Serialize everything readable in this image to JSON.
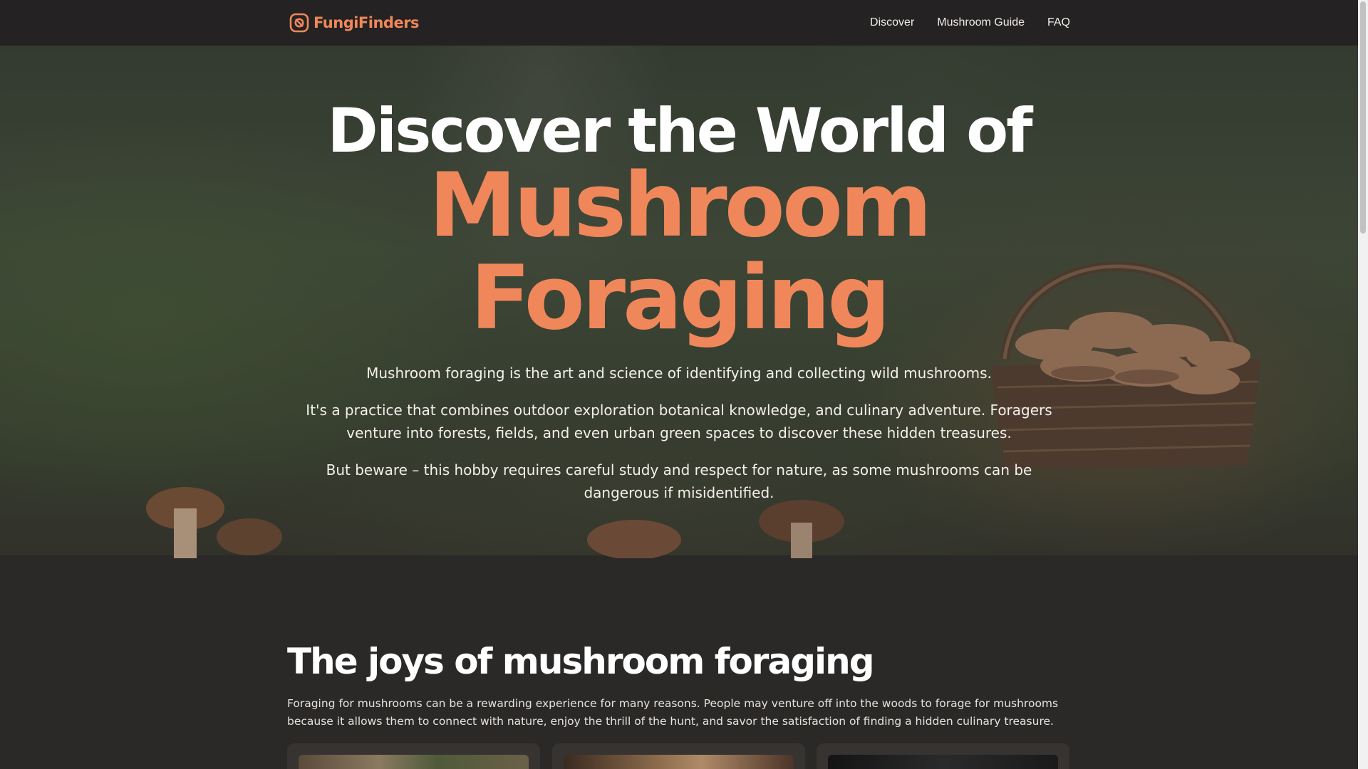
{
  "nav": {
    "brand": "FungiFinders",
    "links": [
      "Discover",
      "Mushroom Guide",
      "FAQ"
    ]
  },
  "hero": {
    "line1": "Discover the World of",
    "line2a": "Mushroom",
    "line2b": "Foraging",
    "p1": "Mushroom foraging is the art and science of identifying and collecting wild mushrooms.",
    "p2": "It's a practice that combines outdoor exploration botanical knowledge, and culinary adventure. Foragers venture into forests, fields, and even urban green spaces to discover these hidden treasures.",
    "p3": "But beware – this hobby requires careful study and respect for nature, as some mushrooms can be dangerous if misidentified."
  },
  "joys": {
    "title": "The joys of mushroom foraging",
    "text": "Foraging for mushrooms can be a rewarding experience for many reasons. People may venture off into the woods to forage for mushrooms because it allows them to connect with nature, enjoy the thrill of the hunt, and savor the satisfaction of finding a hidden culinary treasure."
  },
  "colors": {
    "accent": "#f0875a",
    "background": "#2b2928",
    "nav": "#242222",
    "card": "#363331"
  },
  "icons": {
    "brand": "mushroom-logo-icon"
  }
}
